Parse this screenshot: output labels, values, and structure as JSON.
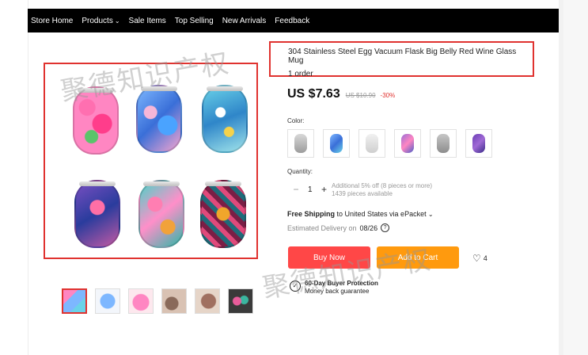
{
  "nav": {
    "items": [
      {
        "label": "Store Home",
        "dropdown": false
      },
      {
        "label": "Products",
        "dropdown": true
      },
      {
        "label": "Sale Items",
        "dropdown": false
      },
      {
        "label": "Top Selling",
        "dropdown": false
      },
      {
        "label": "New Arrivals",
        "dropdown": false
      },
      {
        "label": "Feedback",
        "dropdown": false
      }
    ]
  },
  "watermark": "聚德知识产权",
  "product": {
    "title": "304 Stainless Steel Egg Vacuum Flask Big Belly Red Wine Glass Mug",
    "orders": "1 order",
    "price": "US $7.63",
    "old_price": "US $10.90",
    "discount": "-30%",
    "color_label": "Color:",
    "quantity_label": "Quantity:",
    "quantity_value": "1",
    "quantity_note_1": "Additional 5% off (8 pieces or more)",
    "quantity_note_2": "1439 pieces available",
    "shipping_bold": "Free Shipping",
    "shipping_rest": " to United States via ePacket",
    "delivery_label": "Estimated Delivery on",
    "delivery_date": "08/26",
    "buy_now": "Buy Now",
    "add_to_cart": "Add to Cart",
    "wishlist_count": "4",
    "protection_title": "60-Day Buyer Protection",
    "protection_sub": "Money back guarantee"
  },
  "colors": {
    "accent": "#e0322f",
    "buy_now": "#ff4747",
    "add_to_cart": "#ff9a0e",
    "nav_bg": "#000000"
  }
}
